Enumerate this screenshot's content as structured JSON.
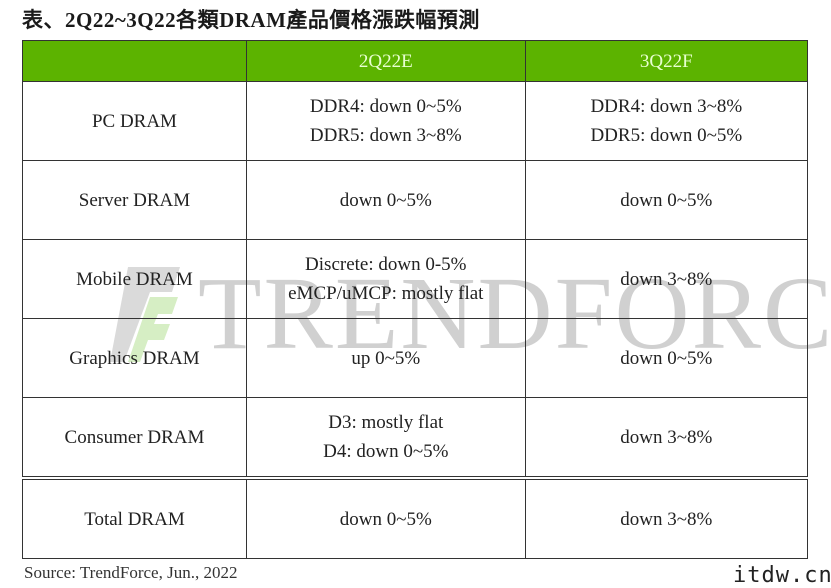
{
  "title": "表、2Q22~3Q22各類DRAM產品價格漲跌幅預測",
  "colors": {
    "header_bg": "#5cb300",
    "header_text": "#e8ffd0"
  },
  "table": {
    "headers": [
      "",
      "2Q22E",
      "3Q22F"
    ],
    "rows": [
      {
        "category": "PC DRAM",
        "q2": [
          "DDR4: down 0~5%",
          "DDR5: down 3~8%"
        ],
        "q3": [
          "DDR4: down 3~8%",
          "DDR5: down 0~5%"
        ]
      },
      {
        "category": "Server DRAM",
        "q2": [
          "down 0~5%"
        ],
        "q3": [
          "down 0~5%"
        ]
      },
      {
        "category": "Mobile DRAM",
        "q2": [
          "Discrete: down 0-5%",
          "eMCP/uMCP: mostly flat"
        ],
        "q3": [
          "down 3~8%"
        ]
      },
      {
        "category": "Graphics DRAM",
        "q2": [
          "up 0~5%"
        ],
        "q3": [
          "down 0~5%"
        ]
      },
      {
        "category": "Consumer DRAM",
        "q2": [
          "D3: mostly flat",
          "D4: down 0~5%"
        ],
        "q3": [
          "down 3~8%"
        ]
      },
      {
        "category": "Total DRAM",
        "q2": [
          "down 0~5%"
        ],
        "q3": [
          "down 3~8%"
        ]
      }
    ]
  },
  "watermark": {
    "text": "TRENDFORCE",
    "logo_icon": "trendforce-logo-icon"
  },
  "source": "Source: TrendForce, Jun., 2022",
  "site_mark": "itdw.cn"
}
